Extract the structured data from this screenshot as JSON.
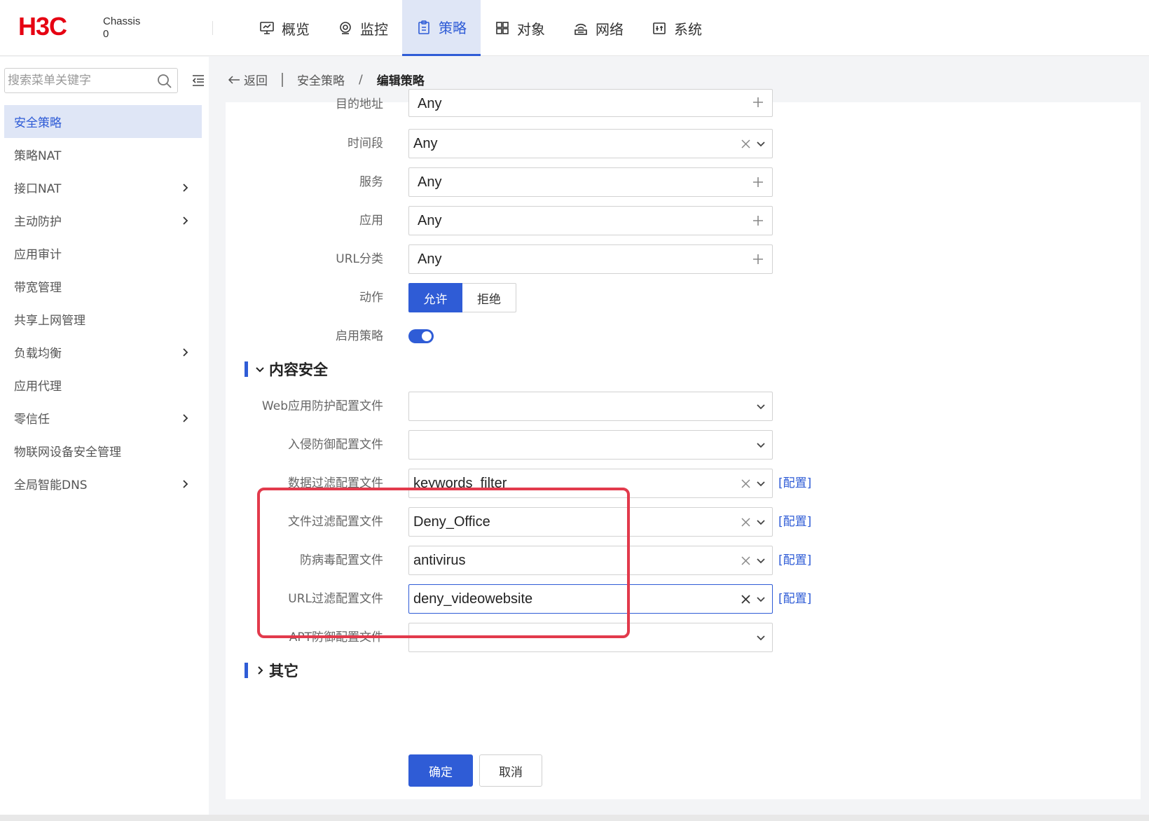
{
  "header": {
    "brand": "H3C",
    "chassis_label": "Chassis",
    "chassis_value": "0",
    "nav": [
      {
        "label": "概览",
        "icon": "monitor-icon"
      },
      {
        "label": "监控",
        "icon": "target-icon"
      },
      {
        "label": "策略",
        "icon": "clipboard-icon",
        "active": true
      },
      {
        "label": "对象",
        "icon": "grid-icon"
      },
      {
        "label": "网络",
        "icon": "network-icon"
      },
      {
        "label": "系统",
        "icon": "settings-box-icon"
      }
    ]
  },
  "sidebar": {
    "search_placeholder": "搜索菜单关键字",
    "items": [
      {
        "label": "安全策略",
        "active": true,
        "has_children": false
      },
      {
        "label": "策略NAT",
        "has_children": false
      },
      {
        "label": "接口NAT",
        "has_children": true
      },
      {
        "label": "主动防护",
        "has_children": true
      },
      {
        "label": "应用审计",
        "has_children": false
      },
      {
        "label": "带宽管理",
        "has_children": false
      },
      {
        "label": "共享上网管理",
        "has_children": false
      },
      {
        "label": "负载均衡",
        "has_children": true
      },
      {
        "label": "应用代理",
        "has_children": false
      },
      {
        "label": "零信任",
        "has_children": true
      },
      {
        "label": "物联网设备安全管理",
        "has_children": false
      },
      {
        "label": "全局智能DNS",
        "has_children": true
      }
    ]
  },
  "breadcrumb": {
    "back": "返回",
    "parent": "安全策略",
    "separator": "/",
    "current": "编辑策略"
  },
  "form": {
    "dest_address": {
      "label": "目的地址",
      "value": "Any"
    },
    "time_range": {
      "label": "时间段",
      "value": "Any"
    },
    "service": {
      "label": "服务",
      "value": "Any"
    },
    "application": {
      "label": "应用",
      "value": "Any"
    },
    "url_category": {
      "label": "URL分类",
      "value": "Any"
    },
    "action": {
      "label": "动作",
      "allow": "允许",
      "deny": "拒绝",
      "selected": "允许"
    },
    "enable_policy": {
      "label": "启用策略",
      "enabled": true
    }
  },
  "content_security": {
    "title": "内容安全",
    "web_app_profile": {
      "label": "Web应用防护配置文件",
      "value": ""
    },
    "ips_profile": {
      "label": "入侵防御配置文件",
      "value": ""
    },
    "data_filter_profile": {
      "label": "数据过滤配置文件",
      "value": "keywords_filter",
      "link": "[配置]"
    },
    "file_filter_profile": {
      "label": "文件过滤配置文件",
      "value": "Deny_Office",
      "link": "[配置]"
    },
    "antivirus_profile": {
      "label": "防病毒配置文件",
      "value": "antivirus",
      "link": "[配置]"
    },
    "url_filter_profile": {
      "label": "URL过滤配置文件",
      "value": "deny_videowebsite",
      "link": "[配置]"
    },
    "apt_profile": {
      "label": "APT防御配置文件",
      "value": ""
    }
  },
  "other_section": {
    "title": "其它"
  },
  "buttons": {
    "ok": "确定",
    "cancel": "取消"
  },
  "colors": {
    "accent": "#2f5cd6",
    "highlight": "#e23a4c",
    "brand_red": "#e60012"
  }
}
